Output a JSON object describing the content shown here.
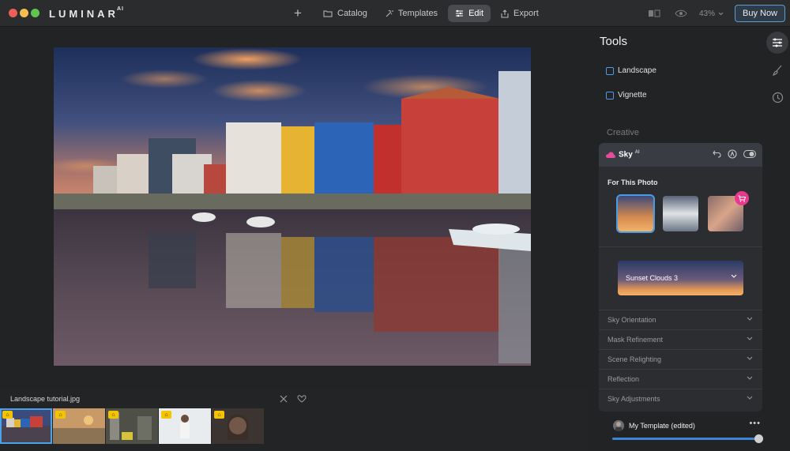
{
  "app": {
    "logo_text": "LUMINAR",
    "logo_sup": "AI"
  },
  "topnav": {
    "add_icon": "plus-icon",
    "items": [
      {
        "label": "Catalog",
        "icon": "folder-icon"
      },
      {
        "label": "Templates",
        "icon": "magic-wand-icon"
      },
      {
        "label": "Edit",
        "icon": "sliders-icon",
        "active": true
      },
      {
        "label": "Export",
        "icon": "share-icon"
      }
    ]
  },
  "toolbar_right": {
    "compare_icon": "compare-icon",
    "preview_icon": "eye-icon",
    "zoom": "43%",
    "buy_label": "Buy Now"
  },
  "filmstrip": {
    "title": "Landscape tutorial.jpg",
    "thumb_count": 5,
    "selected_index": 0
  },
  "panel": {
    "title": "Tools",
    "tools": [
      {
        "label": "Landscape",
        "icon": "image-icon"
      },
      {
        "label": "Vignette",
        "icon": "vignette-icon"
      }
    ],
    "section": "Creative",
    "sky": {
      "name": "Sky",
      "badge": "AI",
      "for_this_photo": "For This Photo",
      "selected_sky": "Sunset Clouds 3",
      "accordions": [
        "Sky Orientation",
        "Mask Refinement",
        "Scene Relighting",
        "Reflection",
        "Sky Adjustments"
      ]
    },
    "template": {
      "name": "My Template (edited)",
      "more": "•••",
      "amount": 1.0
    }
  },
  "colors": {
    "accent": "#4a9be4",
    "buy_border": "#5a9bd4",
    "cart": "#e83a8c"
  }
}
